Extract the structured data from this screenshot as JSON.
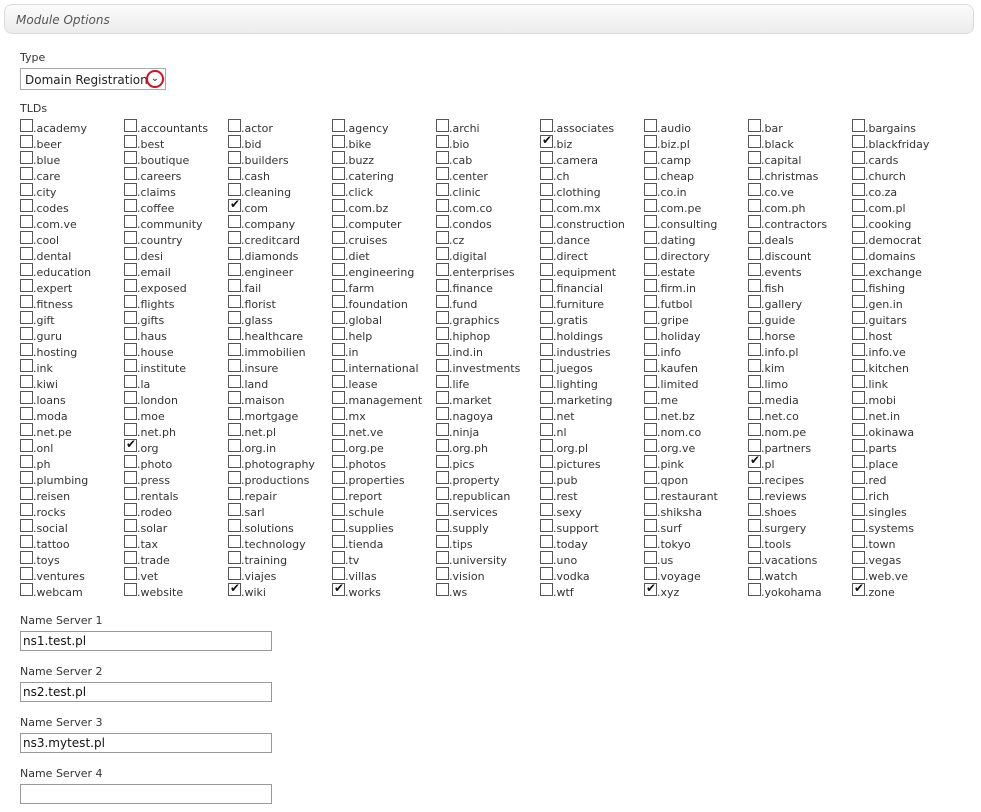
{
  "header": {
    "title": "Module Options"
  },
  "type_field": {
    "label": "Type",
    "value": "Domain Registration"
  },
  "tlds_field": {
    "label": "TLDs",
    "items": [
      {
        "name": ".academy",
        "checked": false
      },
      {
        "name": ".accountants",
        "checked": false
      },
      {
        "name": ".actor",
        "checked": false
      },
      {
        "name": ".agency",
        "checked": false
      },
      {
        "name": ".archi",
        "checked": false
      },
      {
        "name": ".associates",
        "checked": false
      },
      {
        "name": ".audio",
        "checked": false
      },
      {
        "name": ".bar",
        "checked": false
      },
      {
        "name": ".bargains",
        "checked": false
      },
      {
        "name": ".beer",
        "checked": false
      },
      {
        "name": ".best",
        "checked": false
      },
      {
        "name": ".bid",
        "checked": false
      },
      {
        "name": ".bike",
        "checked": false
      },
      {
        "name": ".bio",
        "checked": false
      },
      {
        "name": ".biz",
        "checked": true
      },
      {
        "name": ".biz.pl",
        "checked": false
      },
      {
        "name": ".black",
        "checked": false
      },
      {
        "name": ".blackfriday",
        "checked": false
      },
      {
        "name": ".blue",
        "checked": false
      },
      {
        "name": ".boutique",
        "checked": false
      },
      {
        "name": ".builders",
        "checked": false
      },
      {
        "name": ".buzz",
        "checked": false
      },
      {
        "name": ".cab",
        "checked": false
      },
      {
        "name": ".camera",
        "checked": false
      },
      {
        "name": ".camp",
        "checked": false
      },
      {
        "name": ".capital",
        "checked": false
      },
      {
        "name": ".cards",
        "checked": false
      },
      {
        "name": ".care",
        "checked": false
      },
      {
        "name": ".careers",
        "checked": false
      },
      {
        "name": ".cash",
        "checked": false
      },
      {
        "name": ".catering",
        "checked": false
      },
      {
        "name": ".center",
        "checked": false
      },
      {
        "name": ".ch",
        "checked": false
      },
      {
        "name": ".cheap",
        "checked": false
      },
      {
        "name": ".christmas",
        "checked": false
      },
      {
        "name": ".church",
        "checked": false
      },
      {
        "name": ".city",
        "checked": false
      },
      {
        "name": ".claims",
        "checked": false
      },
      {
        "name": ".cleaning",
        "checked": false
      },
      {
        "name": ".click",
        "checked": false
      },
      {
        "name": ".clinic",
        "checked": false
      },
      {
        "name": ".clothing",
        "checked": false
      },
      {
        "name": ".co.in",
        "checked": false
      },
      {
        "name": ".co.ve",
        "checked": false
      },
      {
        "name": ".co.za",
        "checked": false
      },
      {
        "name": ".codes",
        "checked": false
      },
      {
        "name": ".coffee",
        "checked": false
      },
      {
        "name": ".com",
        "checked": true
      },
      {
        "name": ".com.bz",
        "checked": false
      },
      {
        "name": ".com.co",
        "checked": false
      },
      {
        "name": ".com.mx",
        "checked": false
      },
      {
        "name": ".com.pe",
        "checked": false
      },
      {
        "name": ".com.ph",
        "checked": false
      },
      {
        "name": ".com.pl",
        "checked": false
      },
      {
        "name": ".com.ve",
        "checked": false
      },
      {
        "name": ".community",
        "checked": false
      },
      {
        "name": ".company",
        "checked": false
      },
      {
        "name": ".computer",
        "checked": false
      },
      {
        "name": ".condos",
        "checked": false
      },
      {
        "name": ".construction",
        "checked": false
      },
      {
        "name": ".consulting",
        "checked": false
      },
      {
        "name": ".contractors",
        "checked": false
      },
      {
        "name": ".cooking",
        "checked": false
      },
      {
        "name": ".cool",
        "checked": false
      },
      {
        "name": ".country",
        "checked": false
      },
      {
        "name": ".creditcard",
        "checked": false
      },
      {
        "name": ".cruises",
        "checked": false
      },
      {
        "name": ".cz",
        "checked": false
      },
      {
        "name": ".dance",
        "checked": false
      },
      {
        "name": ".dating",
        "checked": false
      },
      {
        "name": ".deals",
        "checked": false
      },
      {
        "name": ".democrat",
        "checked": false
      },
      {
        "name": ".dental",
        "checked": false
      },
      {
        "name": ".desi",
        "checked": false
      },
      {
        "name": ".diamonds",
        "checked": false
      },
      {
        "name": ".diet",
        "checked": false
      },
      {
        "name": ".digital",
        "checked": false
      },
      {
        "name": ".direct",
        "checked": false
      },
      {
        "name": ".directory",
        "checked": false
      },
      {
        "name": ".discount",
        "checked": false
      },
      {
        "name": ".domains",
        "checked": false
      },
      {
        "name": ".education",
        "checked": false
      },
      {
        "name": ".email",
        "checked": false
      },
      {
        "name": ".engineer",
        "checked": false
      },
      {
        "name": ".engineering",
        "checked": false
      },
      {
        "name": ".enterprises",
        "checked": false
      },
      {
        "name": ".equipment",
        "checked": false
      },
      {
        "name": ".estate",
        "checked": false
      },
      {
        "name": ".events",
        "checked": false
      },
      {
        "name": ".exchange",
        "checked": false
      },
      {
        "name": ".expert",
        "checked": false
      },
      {
        "name": ".exposed",
        "checked": false
      },
      {
        "name": ".fail",
        "checked": false
      },
      {
        "name": ".farm",
        "checked": false
      },
      {
        "name": ".finance",
        "checked": false
      },
      {
        "name": ".financial",
        "checked": false
      },
      {
        "name": ".firm.in",
        "checked": false
      },
      {
        "name": ".fish",
        "checked": false
      },
      {
        "name": ".fishing",
        "checked": false
      },
      {
        "name": ".fitness",
        "checked": false
      },
      {
        "name": ".flights",
        "checked": false
      },
      {
        "name": ".florist",
        "checked": false
      },
      {
        "name": ".foundation",
        "checked": false
      },
      {
        "name": ".fund",
        "checked": false
      },
      {
        "name": ".furniture",
        "checked": false
      },
      {
        "name": ".futbol",
        "checked": false
      },
      {
        "name": ".gallery",
        "checked": false
      },
      {
        "name": ".gen.in",
        "checked": false
      },
      {
        "name": ".gift",
        "checked": false
      },
      {
        "name": ".gifts",
        "checked": false
      },
      {
        "name": ".glass",
        "checked": false
      },
      {
        "name": ".global",
        "checked": false
      },
      {
        "name": ".graphics",
        "checked": false
      },
      {
        "name": ".gratis",
        "checked": false
      },
      {
        "name": ".gripe",
        "checked": false
      },
      {
        "name": ".guide",
        "checked": false
      },
      {
        "name": ".guitars",
        "checked": false
      },
      {
        "name": ".guru",
        "checked": false
      },
      {
        "name": ".haus",
        "checked": false
      },
      {
        "name": ".healthcare",
        "checked": false
      },
      {
        "name": ".help",
        "checked": false
      },
      {
        "name": ".hiphop",
        "checked": false
      },
      {
        "name": ".holdings",
        "checked": false
      },
      {
        "name": ".holiday",
        "checked": false
      },
      {
        "name": ".horse",
        "checked": false
      },
      {
        "name": ".host",
        "checked": false
      },
      {
        "name": ".hosting",
        "checked": false
      },
      {
        "name": ".house",
        "checked": false
      },
      {
        "name": ".immobilien",
        "checked": false
      },
      {
        "name": ".in",
        "checked": false
      },
      {
        "name": ".ind.in",
        "checked": false
      },
      {
        "name": ".industries",
        "checked": false
      },
      {
        "name": ".info",
        "checked": false
      },
      {
        "name": ".info.pl",
        "checked": false
      },
      {
        "name": ".info.ve",
        "checked": false
      },
      {
        "name": ".ink",
        "checked": false
      },
      {
        "name": ".institute",
        "checked": false
      },
      {
        "name": ".insure",
        "checked": false
      },
      {
        "name": ".international",
        "checked": false
      },
      {
        "name": ".investments",
        "checked": false
      },
      {
        "name": ".juegos",
        "checked": false
      },
      {
        "name": ".kaufen",
        "checked": false
      },
      {
        "name": ".kim",
        "checked": false
      },
      {
        "name": ".kitchen",
        "checked": false
      },
      {
        "name": ".kiwi",
        "checked": false
      },
      {
        "name": ".la",
        "checked": false
      },
      {
        "name": ".land",
        "checked": false
      },
      {
        "name": ".lease",
        "checked": false
      },
      {
        "name": ".life",
        "checked": false
      },
      {
        "name": ".lighting",
        "checked": false
      },
      {
        "name": ".limited",
        "checked": false
      },
      {
        "name": ".limo",
        "checked": false
      },
      {
        "name": ".link",
        "checked": false
      },
      {
        "name": ".loans",
        "checked": false
      },
      {
        "name": ".london",
        "checked": false
      },
      {
        "name": ".maison",
        "checked": false
      },
      {
        "name": ".management",
        "checked": false
      },
      {
        "name": ".market",
        "checked": false
      },
      {
        "name": ".marketing",
        "checked": false
      },
      {
        "name": ".me",
        "checked": false
      },
      {
        "name": ".media",
        "checked": false
      },
      {
        "name": ".mobi",
        "checked": false
      },
      {
        "name": ".moda",
        "checked": false
      },
      {
        "name": ".moe",
        "checked": false
      },
      {
        "name": ".mortgage",
        "checked": false
      },
      {
        "name": ".mx",
        "checked": false
      },
      {
        "name": ".nagoya",
        "checked": false
      },
      {
        "name": ".net",
        "checked": false
      },
      {
        "name": ".net.bz",
        "checked": false
      },
      {
        "name": ".net.co",
        "checked": false
      },
      {
        "name": ".net.in",
        "checked": false
      },
      {
        "name": ".net.pe",
        "checked": false
      },
      {
        "name": ".net.ph",
        "checked": false
      },
      {
        "name": ".net.pl",
        "checked": false
      },
      {
        "name": ".net.ve",
        "checked": false
      },
      {
        "name": ".ninja",
        "checked": false
      },
      {
        "name": ".nl",
        "checked": false
      },
      {
        "name": ".nom.co",
        "checked": false
      },
      {
        "name": ".nom.pe",
        "checked": false
      },
      {
        "name": ".okinawa",
        "checked": false
      },
      {
        "name": ".onl",
        "checked": false
      },
      {
        "name": ".org",
        "checked": true
      },
      {
        "name": ".org.in",
        "checked": false
      },
      {
        "name": ".org.pe",
        "checked": false
      },
      {
        "name": ".org.ph",
        "checked": false
      },
      {
        "name": ".org.pl",
        "checked": false
      },
      {
        "name": ".org.ve",
        "checked": false
      },
      {
        "name": ".partners",
        "checked": false
      },
      {
        "name": ".parts",
        "checked": false
      },
      {
        "name": ".ph",
        "checked": false
      },
      {
        "name": ".photo",
        "checked": false
      },
      {
        "name": ".photography",
        "checked": false
      },
      {
        "name": ".photos",
        "checked": false
      },
      {
        "name": ".pics",
        "checked": false
      },
      {
        "name": ".pictures",
        "checked": false
      },
      {
        "name": ".pink",
        "checked": false
      },
      {
        "name": ".pl",
        "checked": true
      },
      {
        "name": ".place",
        "checked": false
      },
      {
        "name": ".plumbing",
        "checked": false
      },
      {
        "name": ".press",
        "checked": false
      },
      {
        "name": ".productions",
        "checked": false
      },
      {
        "name": ".properties",
        "checked": false
      },
      {
        "name": ".property",
        "checked": false
      },
      {
        "name": ".pub",
        "checked": false
      },
      {
        "name": ".qpon",
        "checked": false
      },
      {
        "name": ".recipes",
        "checked": false
      },
      {
        "name": ".red",
        "checked": false
      },
      {
        "name": ".reisen",
        "checked": false
      },
      {
        "name": ".rentals",
        "checked": false
      },
      {
        "name": ".repair",
        "checked": false
      },
      {
        "name": ".report",
        "checked": false
      },
      {
        "name": ".republican",
        "checked": false
      },
      {
        "name": ".rest",
        "checked": false
      },
      {
        "name": ".restaurant",
        "checked": false
      },
      {
        "name": ".reviews",
        "checked": false
      },
      {
        "name": ".rich",
        "checked": false
      },
      {
        "name": ".rocks",
        "checked": false
      },
      {
        "name": ".rodeo",
        "checked": false
      },
      {
        "name": ".sarl",
        "checked": false
      },
      {
        "name": ".schule",
        "checked": false
      },
      {
        "name": ".services",
        "checked": false
      },
      {
        "name": ".sexy",
        "checked": false
      },
      {
        "name": ".shiksha",
        "checked": false
      },
      {
        "name": ".shoes",
        "checked": false
      },
      {
        "name": ".singles",
        "checked": false
      },
      {
        "name": ".social",
        "checked": false
      },
      {
        "name": ".solar",
        "checked": false
      },
      {
        "name": ".solutions",
        "checked": false
      },
      {
        "name": ".supplies",
        "checked": false
      },
      {
        "name": ".supply",
        "checked": false
      },
      {
        "name": ".support",
        "checked": false
      },
      {
        "name": ".surf",
        "checked": false
      },
      {
        "name": ".surgery",
        "checked": false
      },
      {
        "name": ".systems",
        "checked": false
      },
      {
        "name": ".tattoo",
        "checked": false
      },
      {
        "name": ".tax",
        "checked": false
      },
      {
        "name": ".technology",
        "checked": false
      },
      {
        "name": ".tienda",
        "checked": false
      },
      {
        "name": ".tips",
        "checked": false
      },
      {
        "name": ".today",
        "checked": false
      },
      {
        "name": ".tokyo",
        "checked": false
      },
      {
        "name": ".tools",
        "checked": false
      },
      {
        "name": ".town",
        "checked": false
      },
      {
        "name": ".toys",
        "checked": false
      },
      {
        "name": ".trade",
        "checked": false
      },
      {
        "name": ".training",
        "checked": false
      },
      {
        "name": ".tv",
        "checked": false
      },
      {
        "name": ".university",
        "checked": false
      },
      {
        "name": ".uno",
        "checked": false
      },
      {
        "name": ".us",
        "checked": false
      },
      {
        "name": ".vacations",
        "checked": false
      },
      {
        "name": ".vegas",
        "checked": false
      },
      {
        "name": ".ventures",
        "checked": false
      },
      {
        "name": ".vet",
        "checked": false
      },
      {
        "name": ".viajes",
        "checked": false
      },
      {
        "name": ".villas",
        "checked": false
      },
      {
        "name": ".vision",
        "checked": false
      },
      {
        "name": ".vodka",
        "checked": false
      },
      {
        "name": ".voyage",
        "checked": false
      },
      {
        "name": ".watch",
        "checked": false
      },
      {
        "name": ".web.ve",
        "checked": false
      },
      {
        "name": ".webcam",
        "checked": false
      },
      {
        "name": ".website",
        "checked": false
      },
      {
        "name": ".wiki",
        "checked": true
      },
      {
        "name": ".works",
        "checked": true
      },
      {
        "name": ".ws",
        "checked": false
      },
      {
        "name": ".wtf",
        "checked": false
      },
      {
        "name": ".xyz",
        "checked": true
      },
      {
        "name": ".yokohama",
        "checked": false
      },
      {
        "name": ".zone",
        "checked": true
      }
    ]
  },
  "name_servers": [
    {
      "label": "Name Server 1",
      "value": "ns1.test.pl"
    },
    {
      "label": "Name Server 2",
      "value": "ns2.test.pl"
    },
    {
      "label": "Name Server 3",
      "value": "ns3.mytest.pl"
    },
    {
      "label": "Name Server 4",
      "value": ""
    }
  ],
  "icons": {
    "dropdown": "chevron-down-icon",
    "checked": "checkmark-icon"
  },
  "colors": {
    "dropdown_highlight": "#d4101f",
    "header_border": "#dcdcdc"
  }
}
